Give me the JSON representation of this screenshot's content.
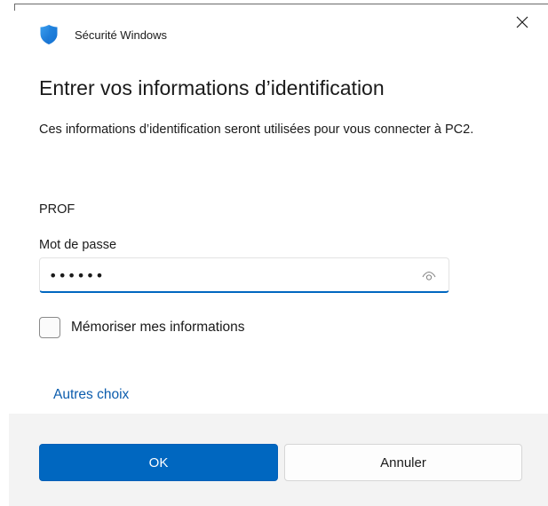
{
  "window": {
    "app_title": "Sécurité Windows",
    "close_icon": "close-icon",
    "shield_icon": "windows-security-shield-icon"
  },
  "main": {
    "heading": "Entrer vos informations d’identification",
    "description": "Ces informations d’identification seront utilisées pour vous connecter à PC2.",
    "username": "PROF",
    "password_label": "Mot de passe",
    "password_value": "••••••",
    "reveal_icon": "eye-icon",
    "remember_label": "Mémoriser mes informations",
    "remember_checked": false,
    "other_choices": "Autres choix"
  },
  "footer": {
    "ok_label": "OK",
    "cancel_label": "Annuler"
  },
  "colors": {
    "accent": "#0067c0",
    "link": "#0b5cad",
    "footer_bg": "#f3f3f3"
  }
}
